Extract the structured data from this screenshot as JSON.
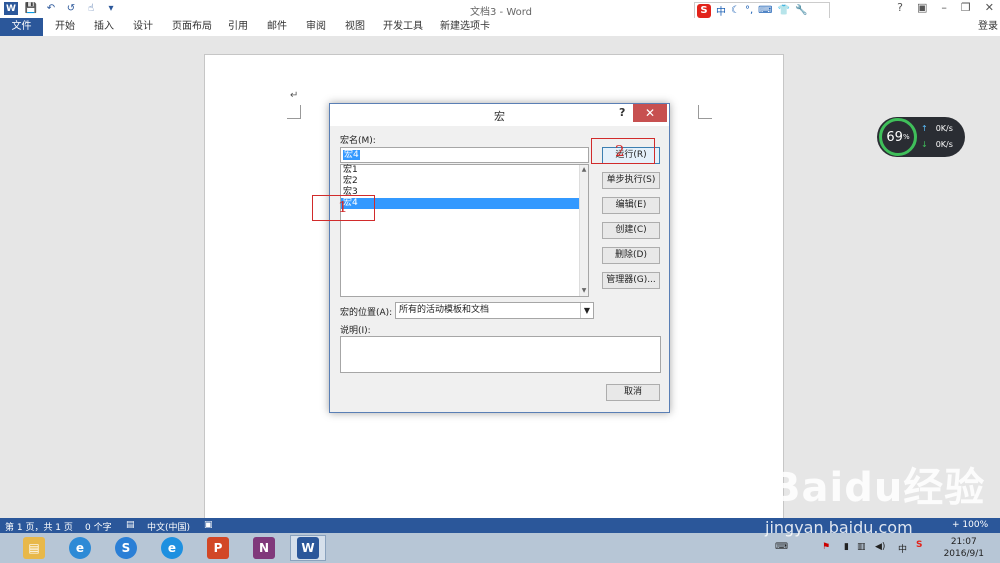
{
  "window": {
    "title": "文档3 - Word",
    "controls": [
      "?",
      "▣",
      "–",
      "❐",
      "✕"
    ]
  },
  "quick_access": {
    "save": "💾",
    "undo": "↶",
    "redo": "↺",
    "touch": "☝",
    "more": "▾"
  },
  "ime": {
    "logo": "S",
    "mode": "中",
    "items": [
      "☾",
      "°,",
      "⌨",
      "👕",
      "🔧"
    ]
  },
  "ribbon": {
    "file": "文件",
    "tabs": [
      "开始",
      "插入",
      "设计",
      "页面布局",
      "引用",
      "邮件",
      "审阅",
      "视图",
      "开发工具",
      "新建选项卡"
    ],
    "login": "登录"
  },
  "speed_widget": {
    "percent": "69",
    "percent_unit": "%",
    "up": "0K/s",
    "down": "0K/s",
    "up_icon": "↑",
    "down_icon": "↓"
  },
  "dialog": {
    "title": "宏",
    "help": "?",
    "close": "✕",
    "name_label": "宏名(M):",
    "name_value": "宏4",
    "macros": [
      "宏1",
      "宏2",
      "宏3",
      "宏4"
    ],
    "selected_index": 3,
    "buttons": {
      "run": "运行(R)",
      "step": "单步执行(S)",
      "edit": "编辑(E)",
      "create": "创建(C)",
      "delete": "删除(D)",
      "organizer": "管理器(G)...",
      "cancel": "取消"
    },
    "location_label": "宏的位置(A):",
    "location_value": "所有的活动模板和文档",
    "description_label": "说明(I):",
    "description_value": "",
    "annotations": [
      "1",
      "2"
    ]
  },
  "status_bar": {
    "page": "第 1 页，共 1 页",
    "words": "0 个字",
    "lang": "中文(中国)",
    "zoom": "+ 100%"
  },
  "taskbar": {
    "apps": [
      "file-explorer",
      "internet-explorer",
      "sogou-browser",
      "edge-ie",
      "powerpoint",
      "onenote",
      "word"
    ],
    "clock_time": "21:07",
    "clock_date": "2016/9/1",
    "tray_ime": "中"
  },
  "watermark": {
    "brand": "Baidu经验",
    "url": "jingyan.baidu.com"
  },
  "colors": {
    "word_blue": "#2b579a",
    "selection": "#3399ff",
    "close_red": "#c75050",
    "annotation_red": "#d12b2b"
  }
}
